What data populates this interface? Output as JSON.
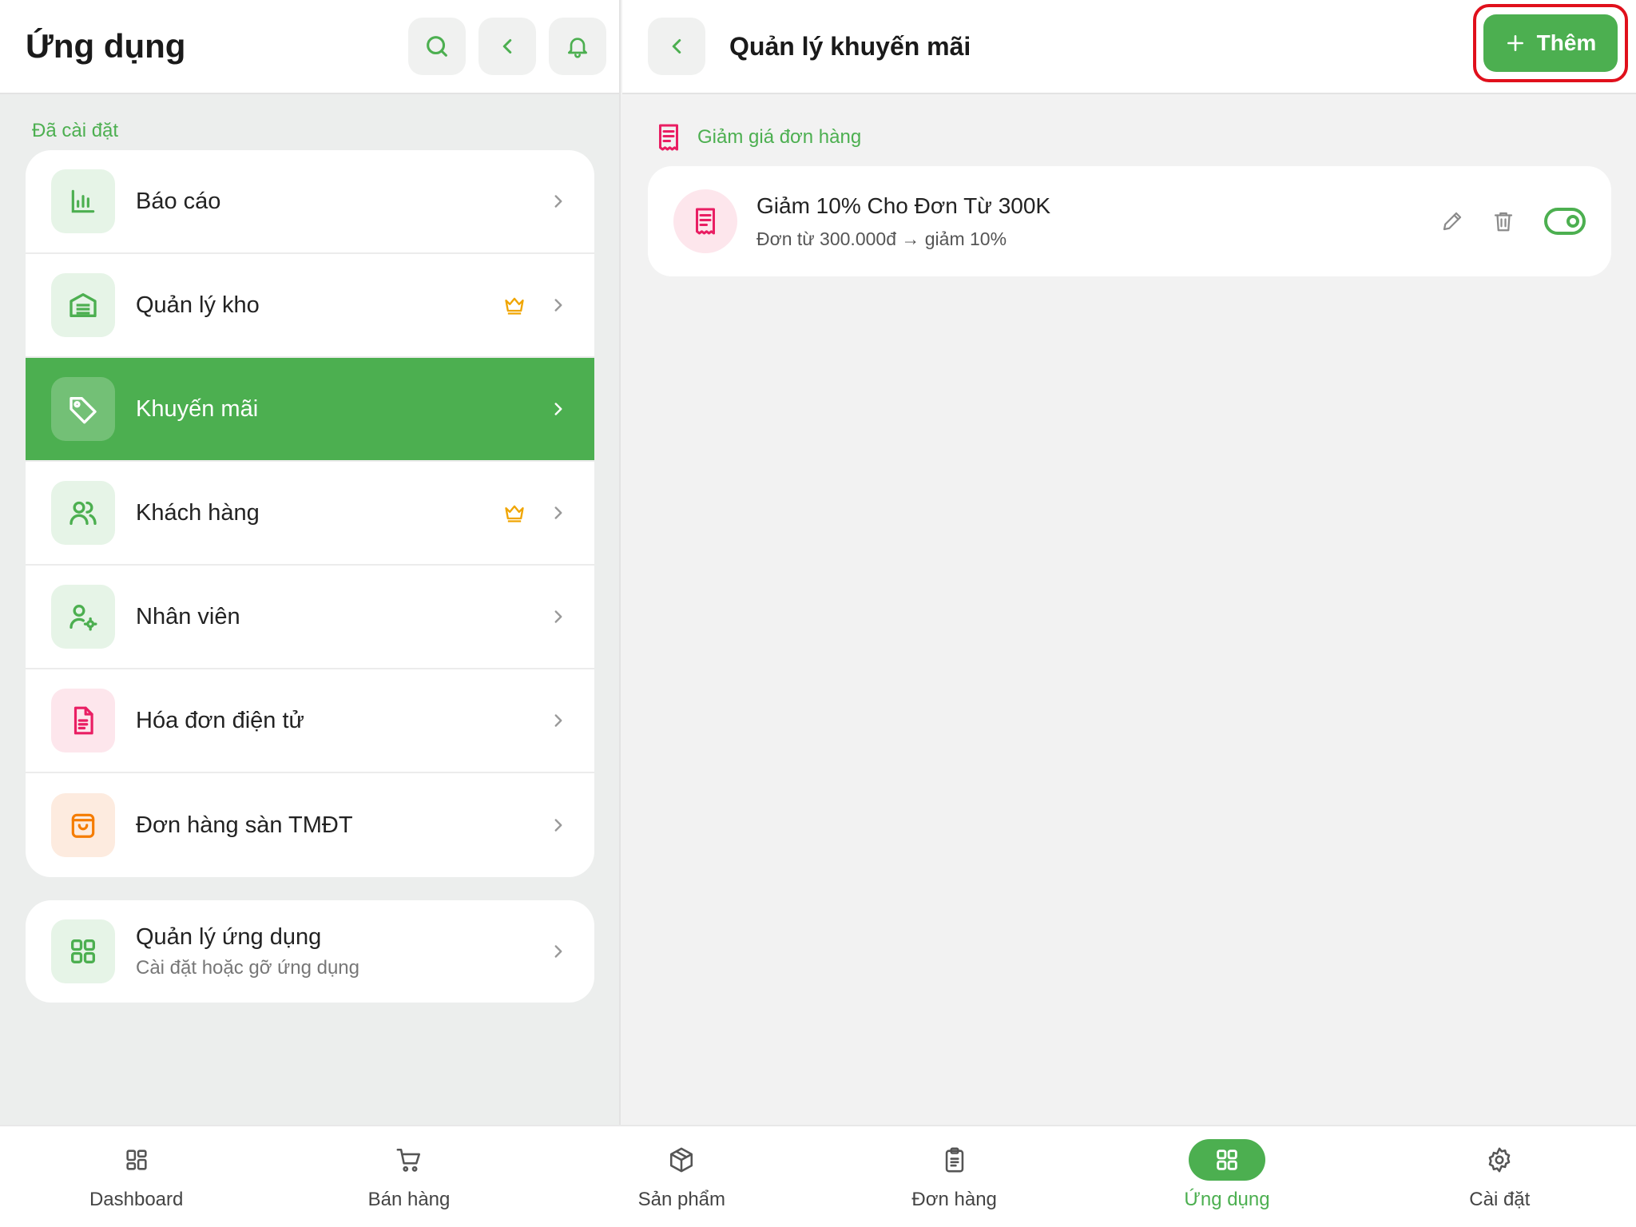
{
  "left": {
    "title": "Ứng dụng",
    "section_label": "Đã cài đặt",
    "items": [
      {
        "label": "Báo cáo",
        "icon": "bar-chart-icon",
        "premium": false,
        "active": false
      },
      {
        "label": "Quản lý kho",
        "icon": "warehouse-icon",
        "premium": true,
        "active": false
      },
      {
        "label": "Khuyến mãi",
        "icon": "tag-icon",
        "premium": false,
        "active": true
      },
      {
        "label": "Khách hàng",
        "icon": "users-icon",
        "premium": true,
        "active": false
      },
      {
        "label": "Nhân viên",
        "icon": "user-cog-icon",
        "premium": false,
        "active": false
      },
      {
        "label": "Hóa đơn điện tử",
        "icon": "file-text-icon",
        "premium": false,
        "active": false
      },
      {
        "label": "Đơn hàng sàn TMĐT",
        "icon": "shopping-bag-icon",
        "premium": false,
        "active": false
      }
    ],
    "manage": {
      "title": "Quản lý ứng dụng",
      "subtitle": "Cài đặt hoặc gỡ ứng dụng",
      "icon": "grid-icon"
    }
  },
  "right": {
    "title": "Quản lý khuyến mãi",
    "add_label": "Thêm",
    "section_label": "Giảm giá đơn hàng",
    "promotions": [
      {
        "title": "Giảm 10% Cho Đơn Từ 300K",
        "description": "Đơn từ 300.000đ → giảm 10%",
        "enabled": true
      }
    ]
  },
  "nav": [
    {
      "label": "Dashboard",
      "icon": "dashboard-icon",
      "active": false
    },
    {
      "label": "Bán hàng",
      "icon": "cart-icon",
      "active": false
    },
    {
      "label": "Sản phẩm",
      "icon": "box-icon",
      "active": false
    },
    {
      "label": "Đơn hàng",
      "icon": "clipboard-icon",
      "active": false
    },
    {
      "label": "Ứng dụng",
      "icon": "apps-icon",
      "active": true
    },
    {
      "label": "Cài đặt",
      "icon": "gear-icon",
      "active": false
    }
  ],
  "colors": {
    "accent": "#4caf50",
    "highlight": "#e0101c",
    "pink": "#e91e63",
    "orange": "#f57c00",
    "gold": "#f0a500"
  }
}
